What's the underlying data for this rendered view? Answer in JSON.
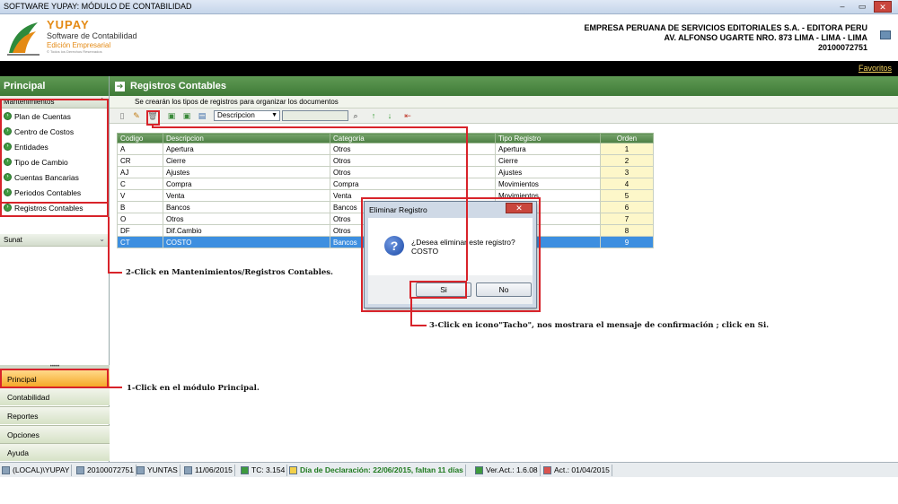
{
  "window": {
    "title": "SOFTWARE YUPAY: MÓDULO DE CONTABILIDAD",
    "min": "–",
    "max": "▭",
    "close": "✕"
  },
  "logo": {
    "name": "YUPAY",
    "product": "Software de Contabilidad",
    "edition": "Edición Empresarial",
    "rights": "© Todos los Derechos Reservados"
  },
  "company": {
    "name": "EMPRESA PERUANA DE SERVICIOS EDITORIALES S.A. - EDITORA PERU",
    "address": "AV. ALFONSO UGARTE NRO. 873 LIMA - LIMA - LIMA",
    "ruc": "20100072751"
  },
  "favorites_label": "Favoritos",
  "left_panel": {
    "title": "Principal",
    "section1": "Mantenimientos",
    "items": [
      {
        "label": "Plan de Cuentas"
      },
      {
        "label": "Centro de Costos"
      },
      {
        "label": "Entidades"
      },
      {
        "label": "Tipo de Cambio"
      },
      {
        "label": "Cuentas Bancarias"
      },
      {
        "label": "Periodos Contables"
      },
      {
        "label": "Registros Contables"
      }
    ],
    "section2": "Sunat",
    "gripper": "•••••",
    "modules": [
      "Principal",
      "Contabilidad",
      "Reportes",
      "Opciones",
      "Ayuda"
    ]
  },
  "main": {
    "title": "Registros Contables",
    "subtitle": "Se crearán los tipos de registros para organizar los documentos",
    "search_field": "Descripcion",
    "columns": [
      "Codigo",
      "Descripcion",
      "Categoria",
      "Tipo Registro",
      "Orden"
    ],
    "rows": [
      [
        "A",
        "Apertura",
        "Otros",
        "Apertura",
        "1"
      ],
      [
        "CR",
        "Cierre",
        "Otros",
        "Cierre",
        "2"
      ],
      [
        "AJ",
        "Ajustes",
        "Otros",
        "Ajustes",
        "3"
      ],
      [
        "C",
        "Compra",
        "Compra",
        "Movimientos",
        "4"
      ],
      [
        "V",
        "Venta",
        "Venta",
        "Movimientos",
        "5"
      ],
      [
        "B",
        "Bancos",
        "Bancos",
        "",
        "6"
      ],
      [
        "O",
        "Otros",
        "Otros",
        "",
        "7"
      ],
      [
        "DF",
        "Dif.Cambio",
        "Otros",
        "",
        "8"
      ],
      [
        "CT",
        "COSTO",
        "Bancos",
        "",
        "9"
      ]
    ]
  },
  "dialog": {
    "title": "Eliminar Registro",
    "message": "¿Desea eliminar este registro?",
    "record": "COSTO",
    "yes": "Si",
    "no": "No",
    "close": "✕"
  },
  "annotations": {
    "step1": "1-Click en el módulo Principal.",
    "step2": "2-Click en Mantenimientos/Registros Contables.",
    "step3": "3-Click en icono\"Tacho\", nos mostrara el mensaje de confirmación ; click en Si."
  },
  "status_bar": {
    "db": "(LOCAL)\\YUPAY",
    "ruc": "20100072751",
    "user": "YUNTAS",
    "date": "11/06/2015",
    "tc": "TC: 3.154",
    "declaration": "Día de Declaración: 22/06/2015, faltan 11 días",
    "version": "Ver.Act.: 1.6.08",
    "act": "Act.: 01/04/2015"
  },
  "colors": {
    "accent_green": "#3f7a37",
    "annotation_red": "#d8232a",
    "selected_row": "#3d8fe0"
  }
}
